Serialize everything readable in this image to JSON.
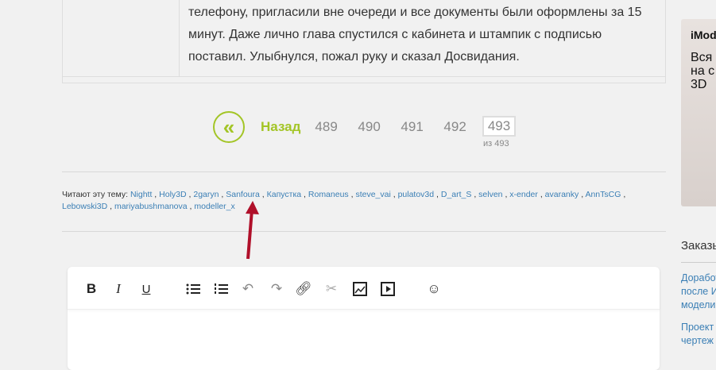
{
  "post": {
    "text": "телефону, пригласили вне очереди и все документы были оформлены за 15 минут. Даже лично глава спустился с кабинета и штампик с подписью поставил. Улыбнулся, пожал руку и сказал Досвидания."
  },
  "pagination": {
    "back_icon": "«",
    "back_label": "Назад",
    "pages": [
      "489",
      "490",
      "491",
      "492"
    ],
    "current": "493",
    "of_label": "из 493"
  },
  "readers": {
    "label": "Читают эту тему:",
    "users": [
      "Nightt",
      "Holy3D",
      "2garyn",
      "Sanfoura",
      "Капустка",
      "Romaneus",
      "steve_vai",
      "pulatov3d",
      "D_art_S",
      "selven",
      "x-ender",
      "avaranky",
      "AnnTsCG",
      "Lebowski3D",
      "mariyabushmanova",
      "modeller_x"
    ]
  },
  "editor": {
    "tools": [
      "bold",
      "italic",
      "underline",
      "bullet-list",
      "numbered-list",
      "undo",
      "redo",
      "link",
      "unlink",
      "image",
      "video",
      "emoji"
    ]
  },
  "sidebar": {
    "ad": {
      "brand": "iMod",
      "text": "Вся на с 3D"
    },
    "title": "Заказы",
    "links": [
      "Доработ после И модели",
      "Проект чертеж"
    ]
  },
  "colors": {
    "accent": "#a3c526",
    "link": "#3b7fb5",
    "arrow": "#b0102a"
  }
}
